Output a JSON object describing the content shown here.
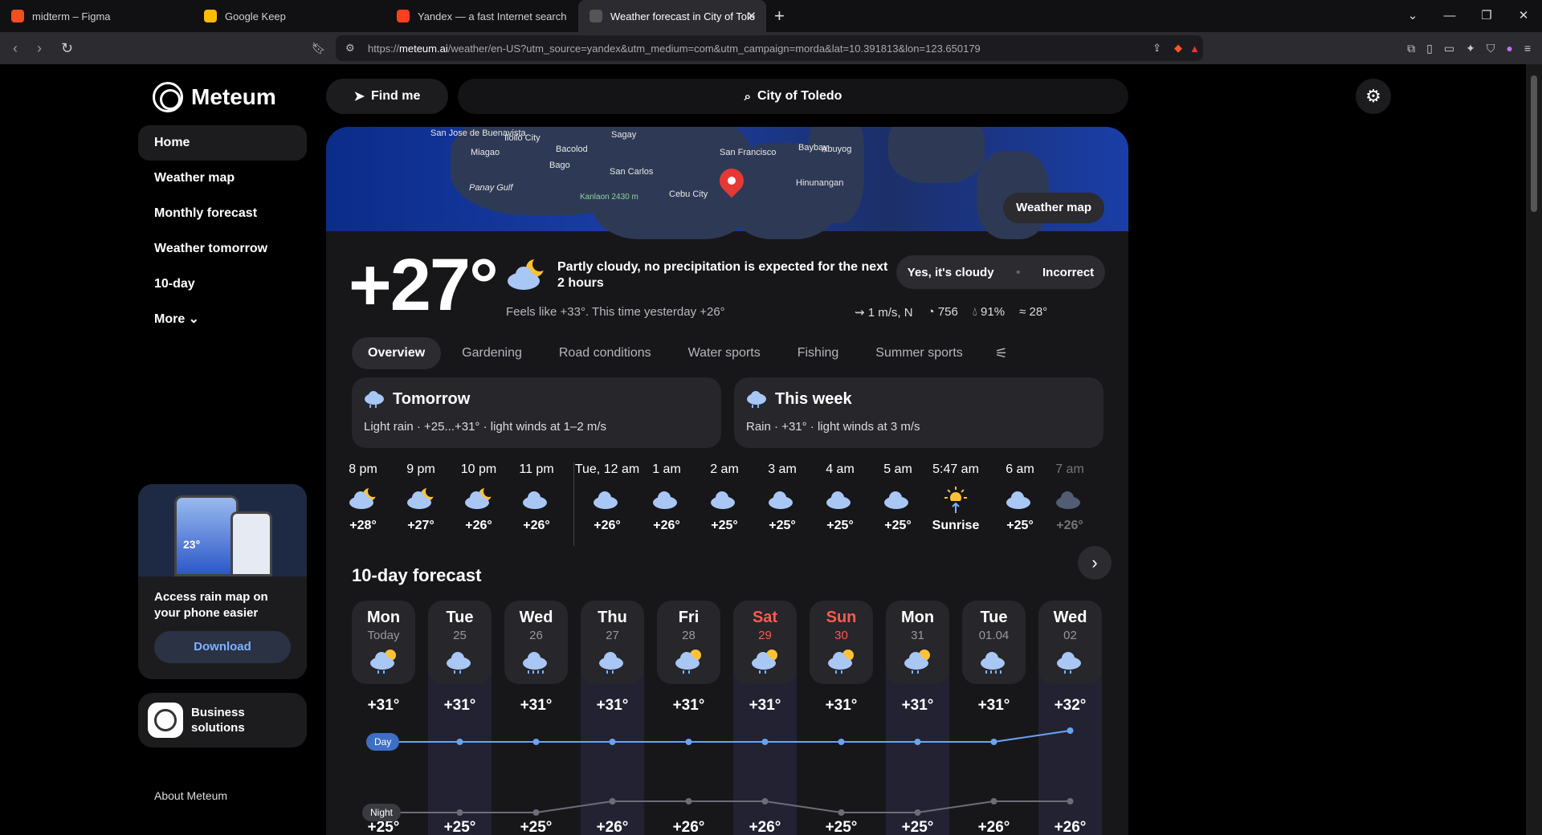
{
  "browser": {
    "tabs": [
      {
        "title": "midterm – Figma",
        "color": "#f24e1e"
      },
      {
        "title": "Google Keep",
        "color": "#fbbc04"
      },
      {
        "title": "Yandex — a fast Internet search",
        "color": "#fc3f1d"
      },
      {
        "title": "Weather forecast in City of Toledo",
        "color": "#555555",
        "active": true
      }
    ],
    "url_prefix": "https://",
    "url_host": "meteum.ai",
    "url_rest": "/weather/en-US?utm_source=yandex&utm_medium=com&utm_campaign=morda&lat=10.391813&lon=123.650179"
  },
  "brand": "Meteum",
  "sidebar": {
    "items": [
      "Home",
      "Weather map",
      "Monthly forecast",
      "Weather tomorrow",
      "10-day",
      "More"
    ],
    "promo_temp": "23°",
    "promo_text": "Access rain map on your phone easier",
    "download": "Download",
    "business": "Business solutions",
    "about": "About Meteum"
  },
  "header": {
    "find_me": "Find me",
    "city": "City of Toledo"
  },
  "map": {
    "labels": [
      "San Jose de Buenavista",
      "Iloilo City",
      "Miagao",
      "Bacolod",
      "Sagay",
      "Bago",
      "San Carlos",
      "Panay Gulf",
      "Kanlaon 2430 m",
      "Cebu City",
      "San Francisco",
      "Baybay",
      "Abuyog",
      "Hinunangan"
    ],
    "button": "Weather map"
  },
  "current": {
    "temp": "+27°",
    "condition": "Partly cloudy, no precipitation is expected for the next 2 hours",
    "feels": "Feels like +33°. This time yesterday +26°",
    "feedback_yes": "Yes, it's cloudy",
    "feedback_no": "Incorrect",
    "wind": "1 m/s, N",
    "pressure": "756",
    "humidity": "91%",
    "water": "28°"
  },
  "tabs": [
    "Overview",
    "Gardening",
    "Road conditions",
    "Water sports",
    "Fishing",
    "Summer sports"
  ],
  "cards": {
    "tomorrow_title": "Tomorrow",
    "tomorrow_text": "Light rain · +25...+31° · light winds at 1–2 m/s",
    "week_title": "This week",
    "week_text": "Rain · +31° · light winds at 3 m/s"
  },
  "hourly": [
    {
      "t": "8 pm",
      "v": "+28°",
      "icon": "moon-cloud"
    },
    {
      "t": "9 pm",
      "v": "+27°",
      "icon": "moon-cloud"
    },
    {
      "t": "10 pm",
      "v": "+26°",
      "icon": "moon-cloud"
    },
    {
      "t": "11 pm",
      "v": "+26°",
      "icon": "cloud"
    },
    {
      "t": "Tue, 12 am",
      "v": "+26°",
      "icon": "cloud"
    },
    {
      "t": "1 am",
      "v": "+26°",
      "icon": "cloud"
    },
    {
      "t": "2 am",
      "v": "+25°",
      "icon": "cloud"
    },
    {
      "t": "3 am",
      "v": "+25°",
      "icon": "cloud"
    },
    {
      "t": "4 am",
      "v": "+25°",
      "icon": "cloud"
    },
    {
      "t": "5 am",
      "v": "+25°",
      "icon": "cloud"
    },
    {
      "t": "5:47 am",
      "v": "Sunrise",
      "icon": "sunrise"
    },
    {
      "t": "6 am",
      "v": "+25°",
      "icon": "cloud"
    },
    {
      "t": "7 am",
      "v": "+26°",
      "icon": "cloud"
    }
  ],
  "ten_day_title": "10-day forecast",
  "ten_day": [
    {
      "name": "Mon",
      "date": "Today",
      "day": 31,
      "night": 25,
      "icon": "sun-rain"
    },
    {
      "name": "Tue",
      "date": "25",
      "day": 31,
      "night": 25,
      "icon": "rain"
    },
    {
      "name": "Wed",
      "date": "26",
      "day": 31,
      "night": 25,
      "icon": "heavy-rain"
    },
    {
      "name": "Thu",
      "date": "27",
      "day": 31,
      "night": 26,
      "icon": "rain"
    },
    {
      "name": "Fri",
      "date": "28",
      "day": 31,
      "night": 26,
      "icon": "sun-rain"
    },
    {
      "name": "Sat",
      "date": "29",
      "day": 31,
      "night": 26,
      "icon": "sun-rain",
      "weekend": true
    },
    {
      "name": "Sun",
      "date": "30",
      "day": 31,
      "night": 25,
      "icon": "sun-rain",
      "weekend": true
    },
    {
      "name": "Mon",
      "date": "31",
      "day": 31,
      "night": 25,
      "icon": "sun-rain"
    },
    {
      "name": "Tue",
      "date": "01.04",
      "day": 31,
      "night": 26,
      "icon": "heavy-rain"
    },
    {
      "name": "Wed",
      "date": "02",
      "day": 32,
      "night": 26,
      "icon": "rain"
    }
  ],
  "labels": {
    "day": "Day",
    "night": "Night"
  },
  "colors": {
    "accent": "#7db2ff",
    "weekend": "#ff5a4e",
    "cloud": "#a9c7f5",
    "sun": "#ffc233"
  }
}
